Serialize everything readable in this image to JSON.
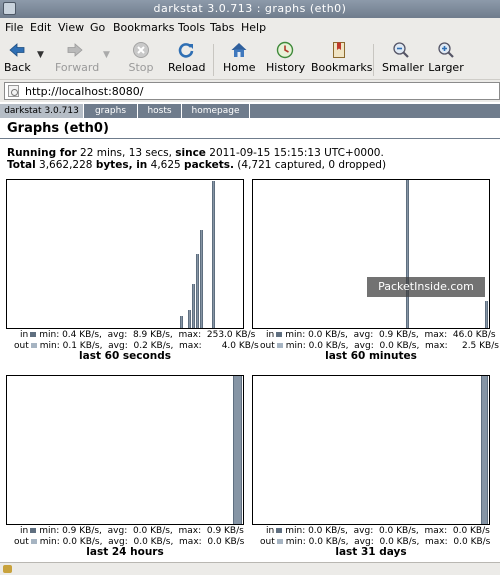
{
  "window": {
    "title": "darkstat 3.0.713 : graphs (eth0)"
  },
  "menu": [
    "File",
    "Edit",
    "View",
    "Go",
    "Bookmarks",
    "Tools",
    "Tabs",
    "Help"
  ],
  "toolbar": {
    "back": "Back",
    "forward": "Forward",
    "stop": "Stop",
    "reload": "Reload",
    "home": "Home",
    "history": "History",
    "bookmarks": "Bookmarks",
    "smaller": "Smaller",
    "larger": "Larger"
  },
  "address": {
    "url": "http://localhost:8080/"
  },
  "nav": [
    "darkstat 3.0.713",
    "graphs",
    "hosts",
    "homepage"
  ],
  "page": {
    "title": "Graphs (eth0)",
    "running_label": "Running for",
    "running_rest": " 22 mins, 13 secs, ",
    "since_label": "since",
    "since_rest": " 2011-09-15 15:15:13 UTC+0000.",
    "total_label": "Total",
    "total_bytes": " 3,662,228 ",
    "bytes_label": "bytes, in",
    "packets_rest": " 4,625 ",
    "packets_label": "packets.",
    "captured_rest": " (4,721 captured, 0 dropped)"
  },
  "watermark": "PacketInside.com",
  "colors": {
    "in": "#5f6f80",
    "out": "#a6b4c2",
    "nav_bg": "#6f7c8c"
  },
  "graphs": [
    {
      "caption": "last 60 seconds",
      "in_legend": "in  ■ min: 0.4 KB/s,  avg:  8.9 KB/s,  max:  253.0 KB/s",
      "out_legend": "out ■ min: 0.1 KB/s,  avg:  0.2 KB/s,  max:       4.0 KB/s",
      "in_line": "min: 0.4 KB/s,  avg:  8.9 KB/s,  max:  253.0 KB/s",
      "out_line": "min: 0.1 KB/s,  avg:  0.2 KB/s,  max:       4.0 KB/s",
      "bars": [
        {
          "i": 44,
          "v": 0.08
        },
        {
          "i": 46,
          "v": 0.12
        },
        {
          "i": 47,
          "v": 0.3
        },
        {
          "i": 48,
          "v": 0.5
        },
        {
          "i": 49,
          "v": 0.66
        },
        {
          "i": 52,
          "v": 0.99
        }
      ],
      "slots": 60
    },
    {
      "caption": "last 60 minutes",
      "in_line": "min: 0.0 KB/s,  avg:  0.9 KB/s,  max:  46.0 KB/s",
      "out_line": "min: 0.0 KB/s,  avg:  0.0 KB/s,  max:     2.5 KB/s",
      "bars": [
        {
          "i": 39,
          "v": 1.0
        },
        {
          "i": 59,
          "v": 0.18
        }
      ],
      "slots": 60
    },
    {
      "caption": "last 24 hours",
      "in_line": "min: 0.9 KB/s,  avg:  0.0 KB/s,  max:  0.9 KB/s",
      "out_line": "min: 0.0 KB/s,  avg:  0.0 KB/s,  max:  0.0 KB/s",
      "bars": [
        {
          "i": 23,
          "v": 1.0
        }
      ],
      "slots": 24
    },
    {
      "caption": "last 31 days",
      "in_line": "min: 0.0 KB/s,  avg:  0.0 KB/s,  max:  0.0 KB/s",
      "out_line": "min: 0.0 KB/s,  avg:  0.0 KB/s,  max:  0.0 KB/s",
      "bars": [
        {
          "i": 30,
          "v": 1.0
        }
      ],
      "slots": 31
    }
  ]
}
